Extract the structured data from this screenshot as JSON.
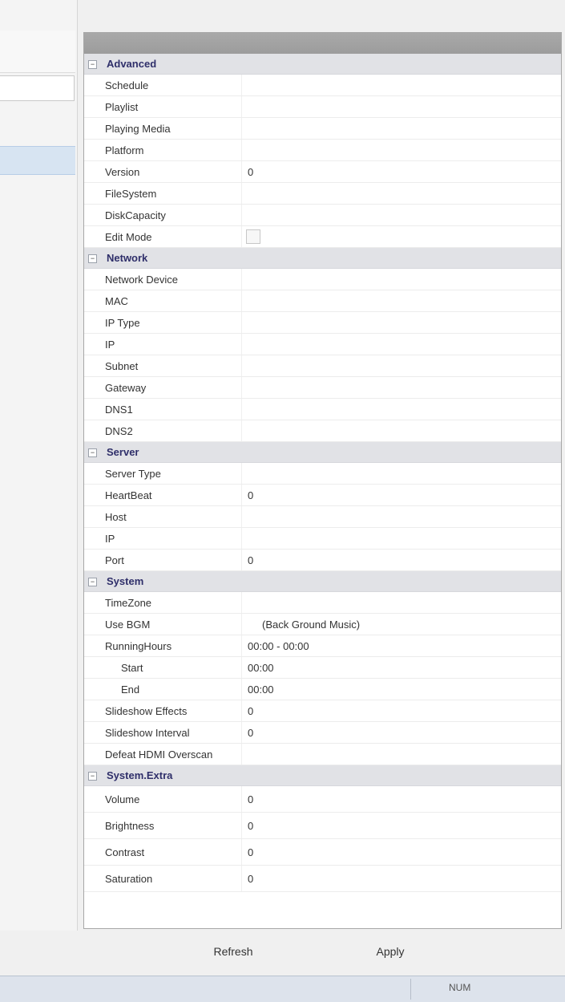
{
  "advanced": {
    "category": "Advanced",
    "rows": [
      {
        "name": "Schedule",
        "value": ""
      },
      {
        "name": "Playlist",
        "value": ""
      },
      {
        "name": "Playing Media",
        "value": ""
      },
      {
        "name": "Platform",
        "value": ""
      },
      {
        "name": "Version",
        "value": "0"
      },
      {
        "name": "FileSystem",
        "value": ""
      },
      {
        "name": "DiskCapacity",
        "value": ""
      },
      {
        "name": "Edit Mode",
        "value": ""
      }
    ]
  },
  "network": {
    "category": "Network",
    "rows": [
      {
        "name": "Network Device",
        "value": ""
      },
      {
        "name": "MAC",
        "value": ""
      },
      {
        "name": "IP Type",
        "value": ""
      },
      {
        "name": "IP",
        "value": ""
      },
      {
        "name": "Subnet",
        "value": ""
      },
      {
        "name": "Gateway",
        "value": ""
      },
      {
        "name": "DNS1",
        "value": ""
      },
      {
        "name": "DNS2",
        "value": ""
      }
    ]
  },
  "server": {
    "category": "Server",
    "rows": [
      {
        "name": "Server Type",
        "value": ""
      },
      {
        "name": "HeartBeat",
        "value": "0"
      },
      {
        "name": "Host",
        "value": ""
      },
      {
        "name": "IP",
        "value": ""
      },
      {
        "name": "Port",
        "value": "0"
      }
    ]
  },
  "system": {
    "category": "System",
    "rows": [
      {
        "name": "TimeZone",
        "value": ""
      },
      {
        "name": "Use BGM",
        "value": "(Back Ground Music)"
      },
      {
        "name": "RunningHours",
        "value": "00:00 - 00:00"
      },
      {
        "name": "Start",
        "value": "00:00"
      },
      {
        "name": "End",
        "value": "00:00"
      },
      {
        "name": "Slideshow Effects",
        "value": "0"
      },
      {
        "name": "Slideshow Interval",
        "value": "0"
      },
      {
        "name": "Defeat HDMI Overscan",
        "value": ""
      }
    ]
  },
  "system_extra": {
    "category": "System.Extra",
    "rows": [
      {
        "name": "Volume",
        "value": "0"
      },
      {
        "name": "Brightness",
        "value": "0"
      },
      {
        "name": "Contrast",
        "value": "0"
      },
      {
        "name": "Saturation",
        "value": "0"
      }
    ]
  },
  "buttons": {
    "refresh": "Refresh",
    "apply": "Apply"
  },
  "status": {
    "num": "NUM"
  }
}
